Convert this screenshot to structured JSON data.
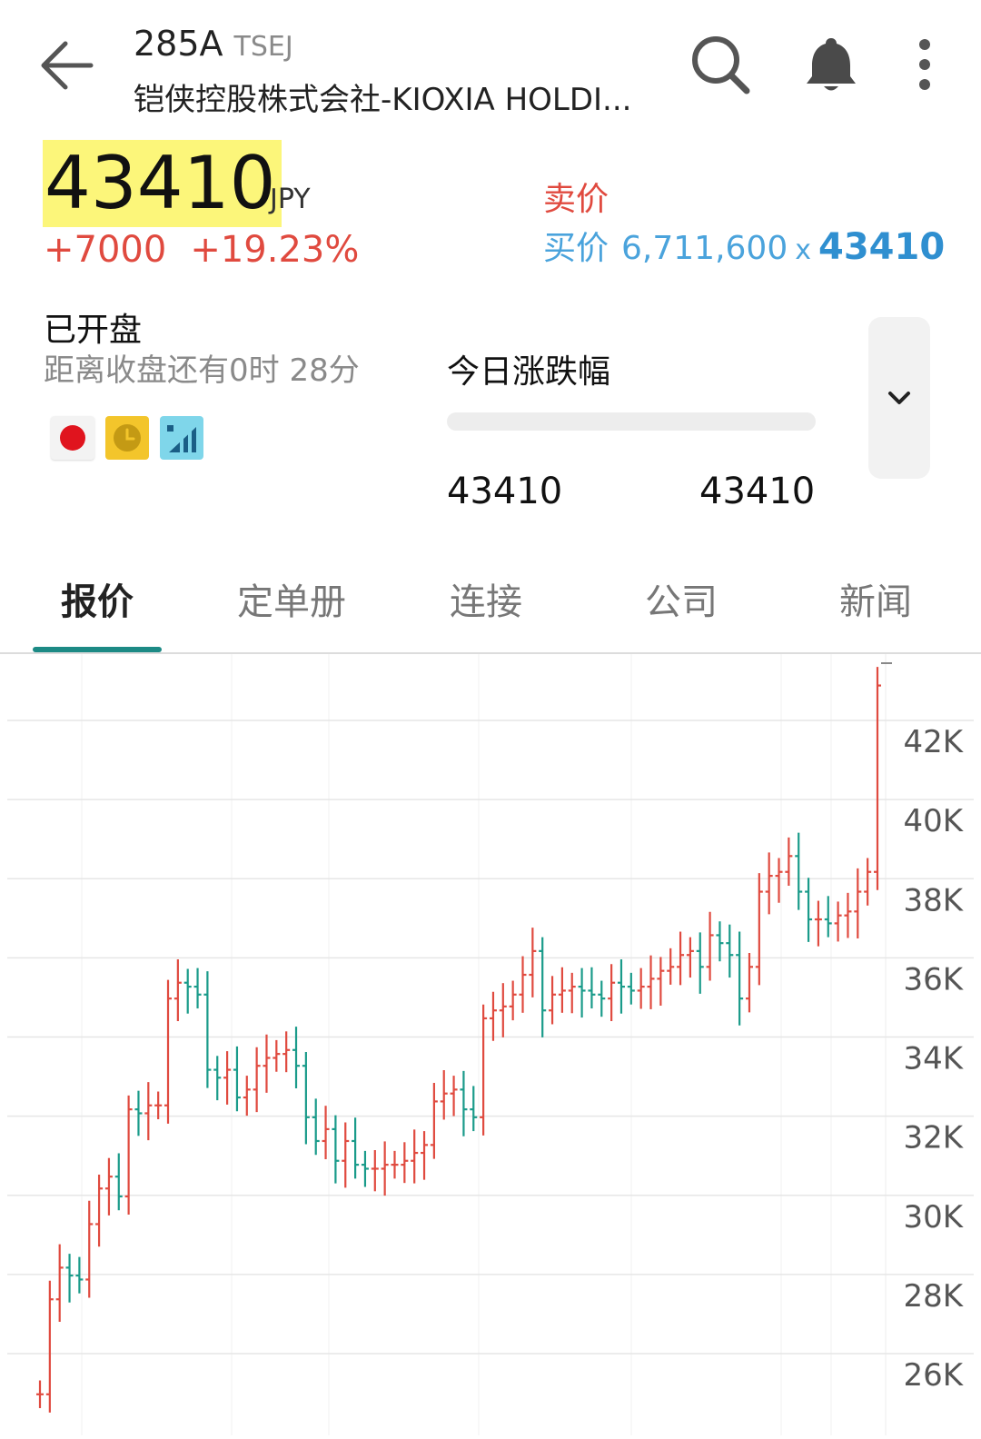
{
  "header": {
    "ticker": "285A",
    "exchange": "TSEJ",
    "company": "铠侠控股株式会社-KIOXIA HOLDI..."
  },
  "quote": {
    "price": "43410",
    "currency": "JPY",
    "change": "+7000",
    "change_pct": "+19.23%",
    "ask_label": "卖价",
    "bid_label": "买价",
    "bid_size": "6,711,600",
    "bid_x": "x",
    "bid_price": "43410"
  },
  "session": {
    "status": "已开盘",
    "countdown": "距离收盘还有0时 28分"
  },
  "badges": [
    "japan-flag-icon",
    "clock-icon",
    "signal-chart-icon"
  ],
  "day_range": {
    "title": "今日涨跌幅",
    "low": "43410",
    "high": "43410"
  },
  "tabs": [
    {
      "label": "报价",
      "active": true
    },
    {
      "label": "定单册",
      "active": false
    },
    {
      "label": "连接",
      "active": false
    },
    {
      "label": "公司",
      "active": false
    },
    {
      "label": "新闻",
      "active": false
    }
  ],
  "colors": {
    "up": "#e04a3f",
    "down": "#1a9b8a",
    "bid": "#4aa3dc",
    "highlight": "#fcf67a",
    "tab_indicator": "#1c8a85"
  },
  "chart_data": {
    "type": "line",
    "subtype": "ohlc-bars",
    "y_ticks": [
      "42K",
      "40K",
      "38K",
      "36K",
      "34K",
      "32K",
      "30K",
      "28K",
      "26K"
    ],
    "y_tick_values": [
      42000,
      40000,
      38000,
      36000,
      34000,
      32000,
      30000,
      28000,
      26000
    ],
    "ylim": [
      25500,
      43500
    ],
    "grid": true,
    "close_series": [
      25500,
      27900,
      28700,
      28500,
      28400,
      29800,
      30700,
      31000,
      30500,
      32700,
      32600,
      32800,
      32800,
      35500,
      35900,
      35800,
      35600,
      33700,
      33500,
      33700,
      33000,
      33200,
      33800,
      34000,
      34100,
      34200,
      33800,
      32500,
      31900,
      32200,
      31400,
      31900,
      31300,
      31200,
      31200,
      31300,
      31300,
      31400,
      31600,
      31800,
      32900,
      33100,
      33200,
      32700,
      32500,
      35000,
      35200,
      35300,
      35600,
      36100,
      36700,
      35200,
      35600,
      35700,
      35800,
      35700,
      35600,
      35500,
      35900,
      35800,
      35700,
      35800,
      36000,
      36200,
      36300,
      36600,
      36700,
      36300,
      37100,
      36900,
      36600,
      35500,
      36300,
      38200,
      38600,
      38700,
      39100,
      38200,
      37500,
      37500,
      37400,
      37600,
      37700,
      38200,
      38700,
      43410
    ]
  }
}
